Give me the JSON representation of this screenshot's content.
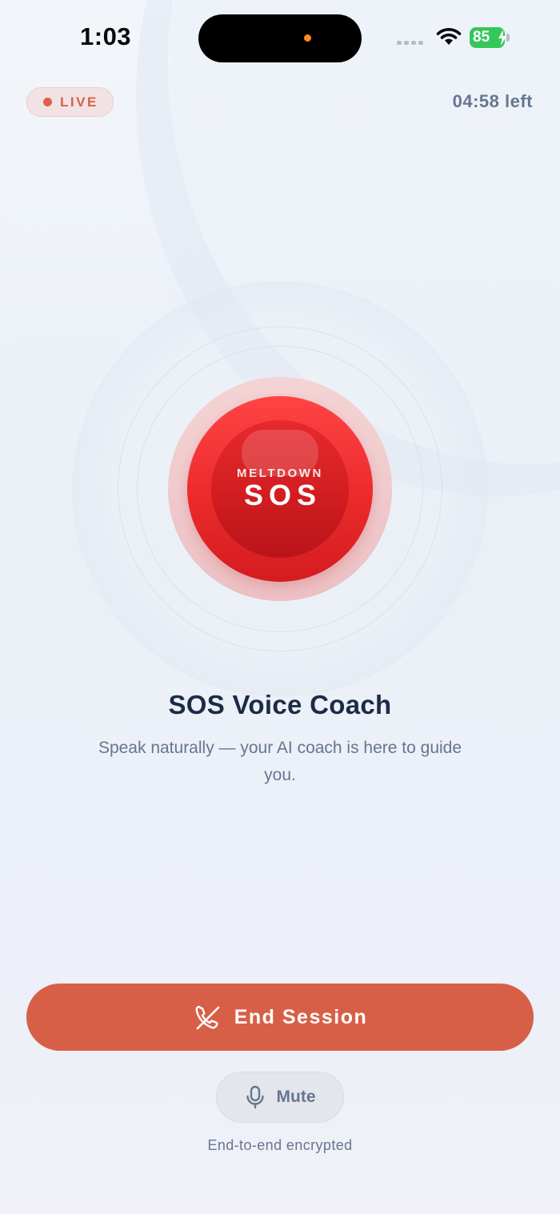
{
  "status_bar": {
    "time": "1:03",
    "battery": "85"
  },
  "header": {
    "live_label": "LIVE",
    "time_left": "04:58 left"
  },
  "sos": {
    "small_text": "MELTDOWN",
    "big_text": "SOS"
  },
  "main": {
    "title": "SOS Voice Coach",
    "subtitle": "Speak naturally — your AI coach is here to guide you."
  },
  "controls": {
    "end_label": "End Session",
    "mute_label": "Mute",
    "footer_note": "End-to-end encrypted"
  },
  "icons": {
    "end": "phone-off-icon",
    "mute": "microphone-icon",
    "wifi": "wifi-icon",
    "battery": "battery-icon",
    "signal": "cellular-signal-icon"
  },
  "colors": {
    "accent": "#d85f47",
    "sos_red": "#ea2a2c",
    "text_dark": "#1c2b45",
    "text_muted": "#66768f",
    "battery_green": "#34c759"
  }
}
